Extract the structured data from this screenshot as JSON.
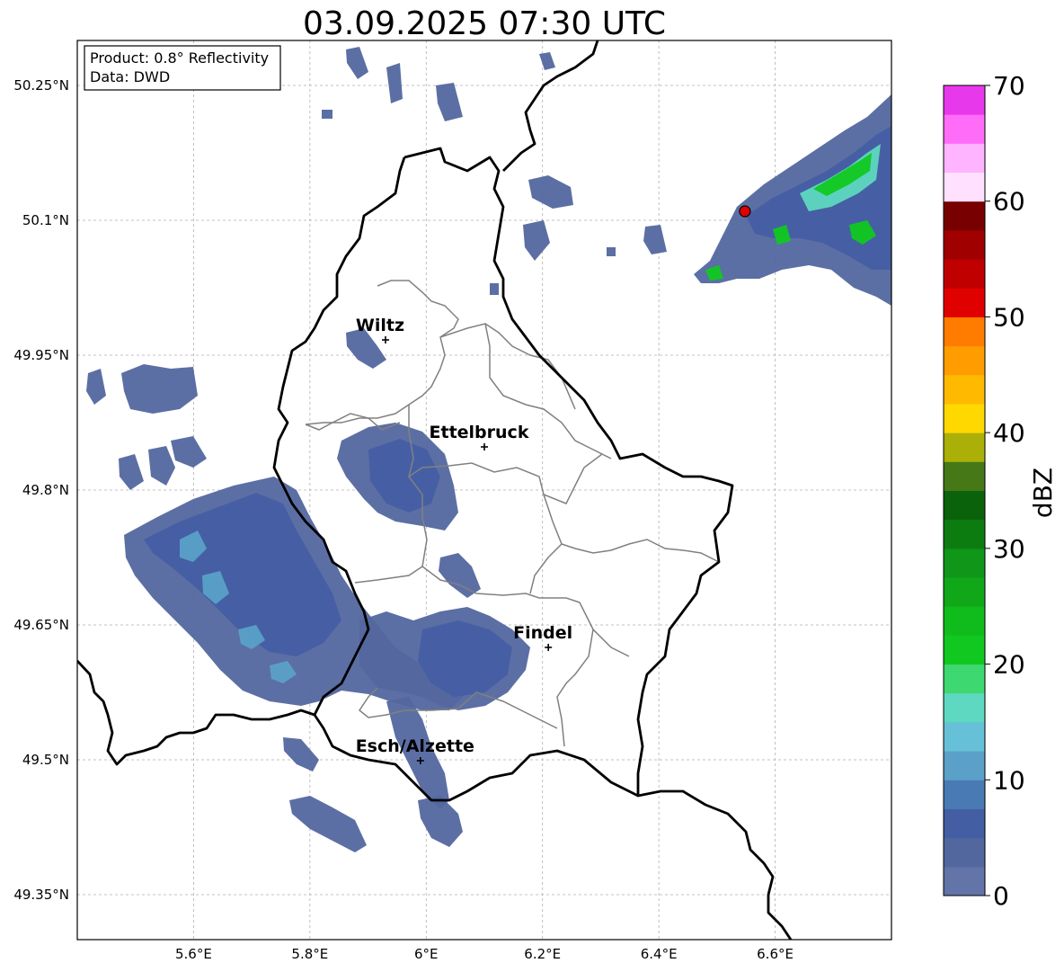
{
  "title": "03.09.2025 07:30 UTC",
  "info_box": {
    "line1": "Product: 0.8° Reflectivity",
    "line2": "Data: DWD"
  },
  "axes": {
    "lon_ticks": [
      {
        "value": 5.6,
        "label": "5.6°E"
      },
      {
        "value": 5.8,
        "label": "5.8°E"
      },
      {
        "value": 6.0,
        "label": "6°E"
      },
      {
        "value": 6.2,
        "label": "6.2°E"
      },
      {
        "value": 6.4,
        "label": "6.4°E"
      },
      {
        "value": 6.6,
        "label": "6.6°E"
      }
    ],
    "lat_ticks": [
      {
        "value": 50.25,
        "label": "50.25°N"
      },
      {
        "value": 50.1,
        "label": "50.1°N"
      },
      {
        "value": 49.95,
        "label": "49.95°N"
      },
      {
        "value": 49.8,
        "label": "49.8°N"
      },
      {
        "value": 49.65,
        "label": "49.65°N"
      },
      {
        "value": 49.5,
        "label": "49.5°N"
      },
      {
        "value": 49.35,
        "label": "49.35°N"
      }
    ],
    "lon_range": [
      5.4,
      6.8
    ],
    "lat_range": [
      49.3,
      50.3
    ],
    "grid": true
  },
  "cities": [
    {
      "name": "Wiltz",
      "lon": 5.93,
      "lat": 49.967
    },
    {
      "name": "Ettelbruck",
      "lon": 6.1,
      "lat": 49.848
    },
    {
      "name": "Findel",
      "lon": 6.21,
      "lat": 49.625
    },
    {
      "name": "Esch/Alzette",
      "lon": 5.99,
      "lat": 49.499
    }
  ],
  "radar_site": {
    "lon": 6.548,
    "lat": 50.11,
    "color": "#e00000"
  },
  "colorbar": {
    "label": "dBZ",
    "min": 0,
    "max": 70,
    "tick_labels": [
      "0",
      "10",
      "20",
      "30",
      "40",
      "50",
      "60",
      "70"
    ],
    "colors": [
      "#6274a8",
      "#53679f",
      "#445ea4",
      "#4a7ab4",
      "#5aa0c8",
      "#66c0d8",
      "#5ed8c0",
      "#3ed870",
      "#10c820",
      "#10bc1c",
      "#10a818",
      "#109618",
      "#0c7c10",
      "#0a620a",
      "#467818",
      "#aab008",
      "#ffd800",
      "#ffba00",
      "#ff9c00",
      "#ff7c00",
      "#e00000",
      "#c00000",
      "#a00000",
      "#780000",
      "#ffe0ff",
      "#ffb4ff",
      "#ff6cf8",
      "#e838ec"
    ]
  },
  "colors": {
    "precip_light": "#53679f",
    "precip_medium": "#445ea4",
    "precip_cyan": "#5aa0c8",
    "precip_green": "#10c820",
    "border": "#000000",
    "canton": "#808080",
    "grid": "#b0b0b0"
  }
}
